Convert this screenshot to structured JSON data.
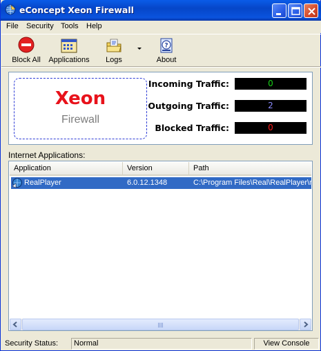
{
  "window": {
    "title": "eConcept Xeon Firewall"
  },
  "menu": [
    "File",
    "Security",
    "Tools",
    "Help"
  ],
  "toolbar": {
    "block_all": "Block All",
    "applications": "Applications",
    "logs": "Logs",
    "about": "About"
  },
  "logo": {
    "main": "Xeon",
    "sub": "Firewall"
  },
  "traffic": {
    "incoming_label": "Incoming Traffic:",
    "incoming_value": "0",
    "incoming_color": "#19d219",
    "outgoing_label": "Outgoing Traffic:",
    "outgoing_value": "2",
    "outgoing_color": "#8c8cff",
    "blocked_label": "Blocked Traffic:",
    "blocked_value": "0",
    "blocked_color": "#ff1a1a"
  },
  "apps": {
    "section_label": "Internet Applications:",
    "columns": [
      "Application",
      "Version",
      "Path"
    ],
    "rows": [
      {
        "application": "RealPlayer",
        "version": "6.0.12.1348",
        "path": "C:\\Program Files\\Real\\RealPlayer\\re"
      }
    ]
  },
  "status": {
    "label": "Security Status:",
    "value": "Normal",
    "view_console": "View Console"
  },
  "colors": {
    "titlebar": "#0a53de",
    "selection": "#316ac5",
    "window_bg": "#ece9d8"
  }
}
